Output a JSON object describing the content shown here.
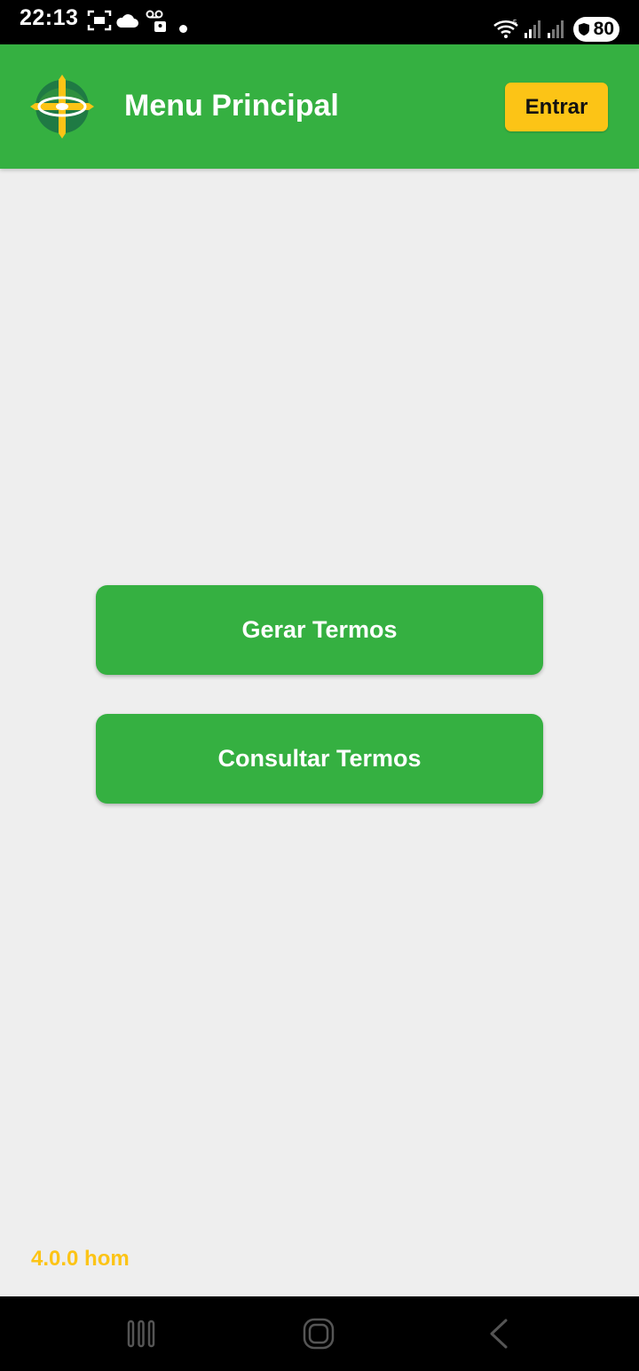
{
  "status_bar": {
    "time": "22:13",
    "battery": "80",
    "icons": [
      "screenshot-icon",
      "cloud-icon",
      "voicemail-icon",
      "notification-dot-icon",
      "wifi-icon",
      "signal-icon",
      "signal-icon-2",
      "battery-icon"
    ]
  },
  "app_bar": {
    "title": "Menu Principal",
    "login_label": "Entrar",
    "logo_icon": "app-logo-icon"
  },
  "main": {
    "generate_label": "Gerar Termos",
    "consult_label": "Consultar Termos"
  },
  "footer": {
    "version": "4.0.0 hom"
  },
  "nav_bar": {
    "icons": [
      "recent-apps-icon",
      "home-icon",
      "back-icon"
    ]
  },
  "colors": {
    "primary_green": "#35b041",
    "accent_yellow": "#fcc416",
    "background": "#eeeeee"
  }
}
